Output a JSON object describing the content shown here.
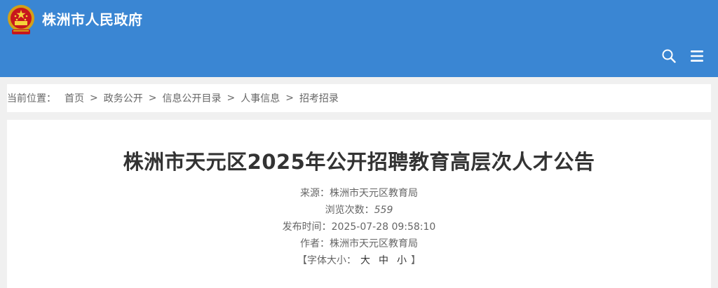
{
  "header": {
    "site_title": "株洲市人民政府",
    "bg_color": "#3a86d3",
    "search_icon": "search-icon",
    "menu_icon": "menu-icon"
  },
  "breadcrumb": {
    "label": "当前位置：",
    "items": [
      "首页",
      "政务公开",
      "信息公开目录",
      "人事信息",
      "招考招录"
    ],
    "separator": ">"
  },
  "article": {
    "title": "株洲市天元区2025年公开招聘教育高层次人才公告",
    "source_label": "来源：",
    "source": "株洲市天元区教育局",
    "views_label": "浏览次数：",
    "views": "559",
    "published_label": "发布时间：",
    "published": "2025-07-28 09:58:10",
    "author_label": "作者：",
    "author": "株洲市天元区教育局",
    "font_size_open": "【字体大小：",
    "font_size_large": "大",
    "font_size_medium": "中",
    "font_size_small": "小",
    "font_size_close": "】"
  }
}
